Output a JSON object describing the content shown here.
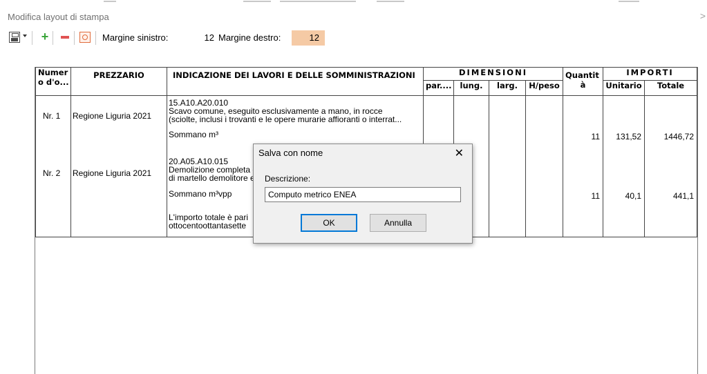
{
  "window": {
    "title": "Modifica layout di stampa",
    "close_glyph": ">"
  },
  "toolbar": {
    "margin_left_label": "Margine sinistro:",
    "margin_left_value": "12",
    "margin_right_label": "Margine destro:",
    "margin_right_value": "12",
    "margin_right_bg": "#f5caa5"
  },
  "table": {
    "headers": {
      "number": [
        "Numer",
        "o d'o..."
      ],
      "prezzario": "PREZZARIO",
      "description": "INDICAZIONE DEI LAVORI E DELLE SOMMINISTRAZIONI",
      "dimensions": "DIMENSIONI",
      "dim_cols": [
        "par....",
        "lung.",
        "larg.",
        "H/peso"
      ],
      "quantity": [
        "Quantit",
        "à"
      ],
      "importi": "IMPORTI",
      "importi_cols": [
        "Unitario",
        "Totale"
      ]
    },
    "rows": [
      {
        "number": "Nr. 1",
        "prezzario": "Regione Liguria 2021",
        "code": "15.A10.A20.010",
        "desc_line1": "Scavo comune, eseguito esclusivamente a mano, in rocce",
        "desc_line2": "(sciolte, inclusi i trovanti e le opere murarie affioranti o interrat...",
        "summary": "Sommano m³",
        "quantity": "11",
        "unit_price": "131,52",
        "total": "1446,72"
      },
      {
        "number": "Nr. 2",
        "prezzario": "Regione Liguria 2021",
        "code": "20.A05.A10.015",
        "desc_line1": "Demolizione completa c",
        "desc_line2": "di martello demolitore e",
        "summary": "Sommano m³vpp",
        "quantity": "11",
        "unit_price": "40,1",
        "total": "441,1"
      }
    ],
    "footer_line1": "L'importo totale è pari",
    "footer_line2": "ottocentoottantasette"
  },
  "dialog": {
    "title": "Salva con nome",
    "close_glyph": "✕",
    "label": "Descrizione:",
    "input_value": "Computo metrico ENEA",
    "ok_label": "OK",
    "cancel_label": "Annulla"
  }
}
